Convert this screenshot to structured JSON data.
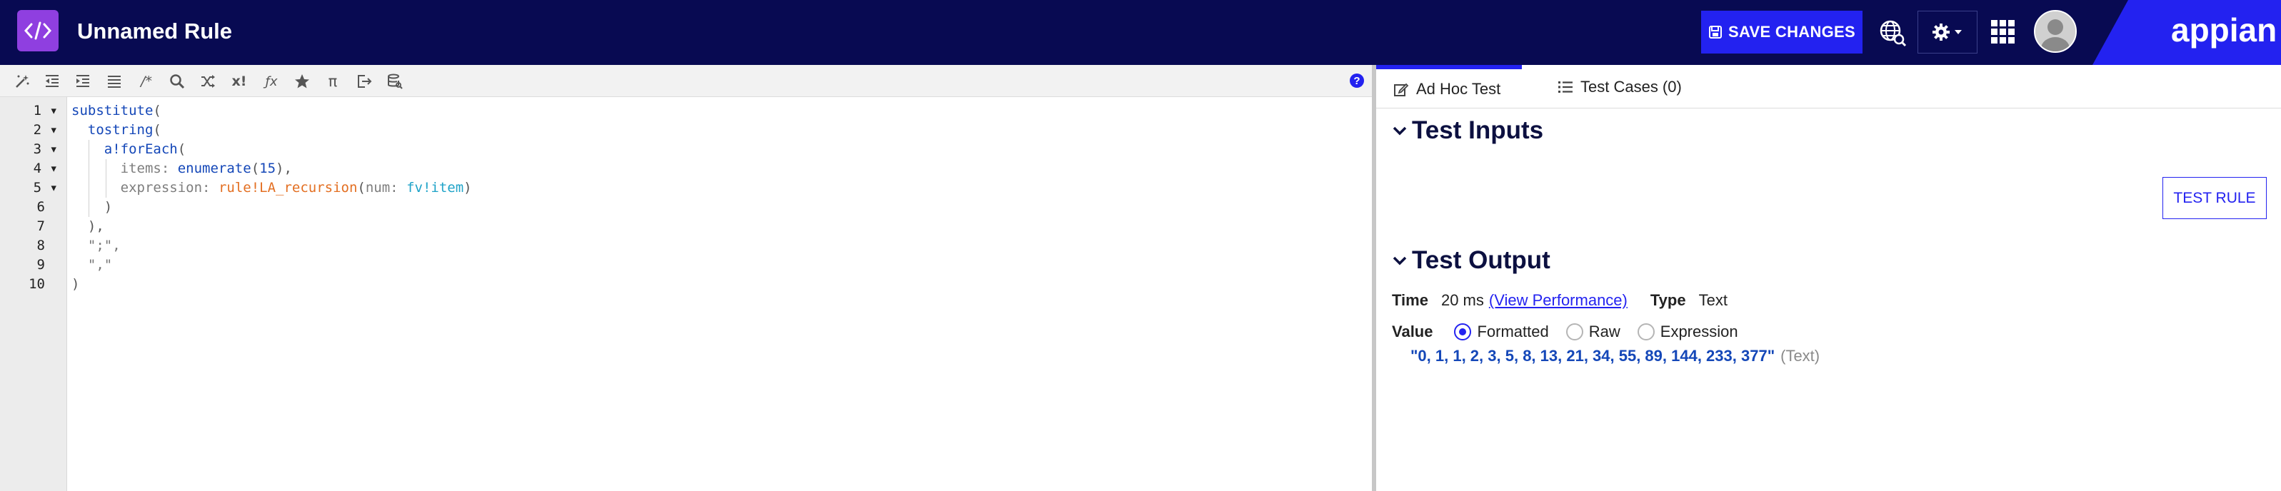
{
  "header": {
    "title": "Unnamed Rule",
    "save_label": "SAVE CHANGES",
    "brand": "appian",
    "colors": {
      "bar": "#080a52",
      "accent": "#2322f0",
      "rule_icon": "#8f3fe0"
    }
  },
  "editor": {
    "toolbar_icons": [
      "magic-wand-icon",
      "outdent-icon",
      "indent-icon",
      "list-icon",
      "comment-icon",
      "search-icon",
      "shuffle-icon",
      "exclamation-x-icon",
      "function-icon",
      "star-icon",
      "pi-icon",
      "export-icon",
      "database-search-icon"
    ],
    "toolbar_glyphs": [
      "/*",
      "x!",
      "ƒx",
      "π"
    ],
    "help_label": "?",
    "line_numbers": [
      "1",
      "2",
      "3",
      "4",
      "5",
      "6",
      "7",
      "8",
      "9",
      "10"
    ],
    "lines": [
      {
        "text": "substitute("
      },
      {
        "text": "  tostring("
      },
      {
        "text": "    a!forEach("
      },
      {
        "text": "      items: enumerate(15),"
      },
      {
        "text": "      expression: rule!LA_recursion(num: fv!item)"
      },
      {
        "text": "    )"
      },
      {
        "text": "  ),"
      },
      {
        "text": "  \";\","
      },
      {
        "text": "  \",\""
      },
      {
        "text": ")"
      }
    ],
    "tokens": {
      "l1_fn": "substitute",
      "l1_p": "(",
      "l2_fn": "tostring",
      "l2_p": "(",
      "l3_fn": "a!forEach",
      "l3_p": "(",
      "l4_kw": "items:",
      "l4_fn": "enumerate",
      "l4_num": "15",
      "l4_end": "),",
      "l5_kw": "expression:",
      "l5_rule": "rule!LA_recursion",
      "l5_kw2": "num:",
      "l5_fv": "fv!item",
      "l5_end": ")",
      "l6": ")",
      "l7": "),",
      "l8": "\";\",",
      "l9": "\",\"",
      "l10": ")"
    }
  },
  "right": {
    "tabs": [
      {
        "label": "Ad Hoc Test",
        "active": true
      },
      {
        "label": "Test Cases (0)",
        "active": false
      }
    ],
    "test_inputs_title": "Test Inputs",
    "test_rule_label": "TEST RULE",
    "test_output_title": "Test Output",
    "time_label": "Time",
    "time_value": "20 ms",
    "view_performance": "(View Performance)",
    "type_label": "Type",
    "type_value": "Text",
    "value_label": "Value",
    "value_options": [
      "Formatted",
      "Raw",
      "Expression"
    ],
    "value_selected": "Formatted",
    "result": "\"0, 1, 1, 2, 3, 5, 8, 13, 21, 34, 55, 89, 144, 233, 377\"",
    "result_type": "(Text)"
  }
}
